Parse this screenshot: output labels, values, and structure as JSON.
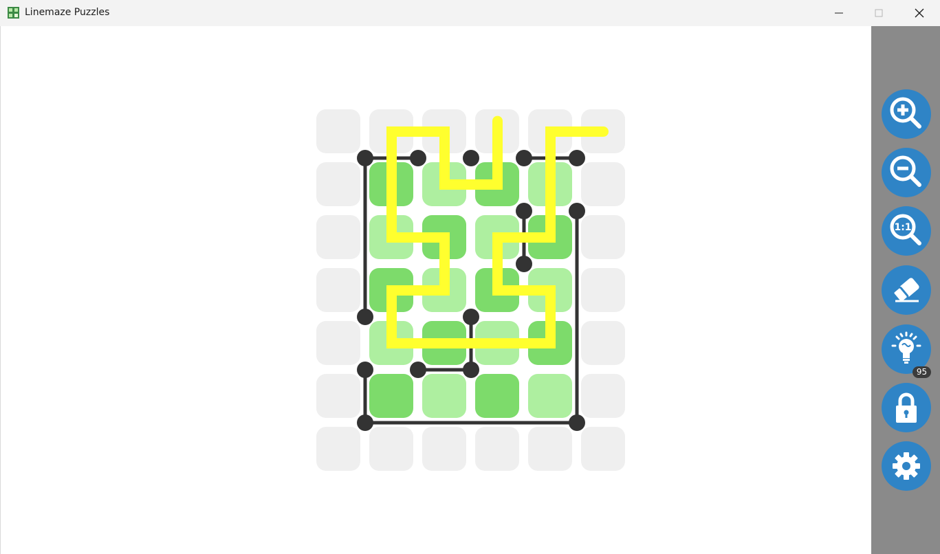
{
  "window": {
    "title": "Linemaze Puzzles",
    "icon": "linemaze-app-icon",
    "controls": [
      "minimize-icon",
      "maximize-icon",
      "close-icon"
    ]
  },
  "toolbar": {
    "buttons": [
      {
        "name": "zoom-in",
        "icon": "zoom-in-icon"
      },
      {
        "name": "zoom-out",
        "icon": "zoom-out-icon"
      },
      {
        "name": "zoom-actual-size",
        "icon": "zoom-1-1-icon",
        "label": "1:1"
      },
      {
        "name": "eraser",
        "icon": "eraser-icon"
      },
      {
        "name": "hint",
        "icon": "lightbulb-icon",
        "badge": "95"
      },
      {
        "name": "lock",
        "icon": "lock-icon"
      },
      {
        "name": "settings",
        "icon": "gear-icon"
      }
    ]
  },
  "puzzle": {
    "columns": 6,
    "rows": 7,
    "cells": [
      [
        "empty",
        "empty",
        "empty",
        "empty",
        "empty",
        "empty"
      ],
      [
        "empty",
        "dark",
        "light",
        "dark",
        "light",
        "empty"
      ],
      [
        "empty",
        "light",
        "dark",
        "light",
        "dark",
        "empty"
      ],
      [
        "empty",
        "dark",
        "light",
        "dark",
        "light",
        "empty"
      ],
      [
        "empty",
        "light",
        "dark",
        "light",
        "dark",
        "empty"
      ],
      [
        "empty",
        "dark",
        "light",
        "dark",
        "light",
        "empty"
      ],
      [
        "empty",
        "empty",
        "empty",
        "empty",
        "empty",
        "empty"
      ]
    ],
    "walls": [
      [
        [
          1,
          1
        ],
        [
          2,
          1
        ]
      ],
      [
        [
          1,
          1
        ],
        [
          1,
          4
        ]
      ],
      [
        [
          4,
          1
        ],
        [
          5,
          1
        ]
      ],
      [
        [
          4,
          2
        ],
        [
          4,
          3
        ]
      ],
      [
        [
          5,
          2
        ],
        [
          5,
          6
        ]
      ],
      [
        [
          2,
          5
        ],
        [
          3,
          5
        ]
      ],
      [
        [
          3,
          4
        ],
        [
          3,
          5
        ]
      ],
      [
        [
          1,
          5
        ],
        [
          1,
          6
        ]
      ],
      [
        [
          1,
          6
        ],
        [
          5,
          6
        ]
      ]
    ],
    "dots": [
      [
        1,
        1
      ],
      [
        2,
        1
      ],
      [
        3,
        1
      ],
      [
        4,
        1
      ],
      [
        5,
        1
      ],
      [
        4,
        2
      ],
      [
        5,
        2
      ],
      [
        4,
        3
      ],
      [
        1,
        4
      ],
      [
        3,
        4
      ],
      [
        1,
        5
      ],
      [
        2,
        5
      ],
      [
        3,
        5
      ],
      [
        1,
        6
      ],
      [
        5,
        6
      ]
    ],
    "path": [
      [
        3.5,
        0.3
      ],
      [
        3.5,
        1.5
      ],
      [
        2.5,
        1.5
      ],
      [
        2.5,
        0.5
      ],
      [
        1.5,
        0.5
      ],
      [
        1.5,
        2.5
      ],
      [
        2.5,
        2.5
      ],
      [
        2.5,
        3.5
      ],
      [
        1.5,
        3.5
      ],
      [
        1.5,
        4.5
      ],
      [
        4.5,
        4.5
      ],
      [
        4.5,
        3.5
      ],
      [
        3.5,
        3.5
      ],
      [
        3.5,
        2.5
      ],
      [
        4.5,
        2.5
      ],
      [
        4.5,
        0.5
      ],
      [
        5.5,
        0.5
      ]
    ],
    "colors": {
      "empty": "#efefef",
      "dark": "#7ddb6b",
      "light": "#aeefa0",
      "wall": "#333333",
      "path": "#ffff2e"
    }
  }
}
